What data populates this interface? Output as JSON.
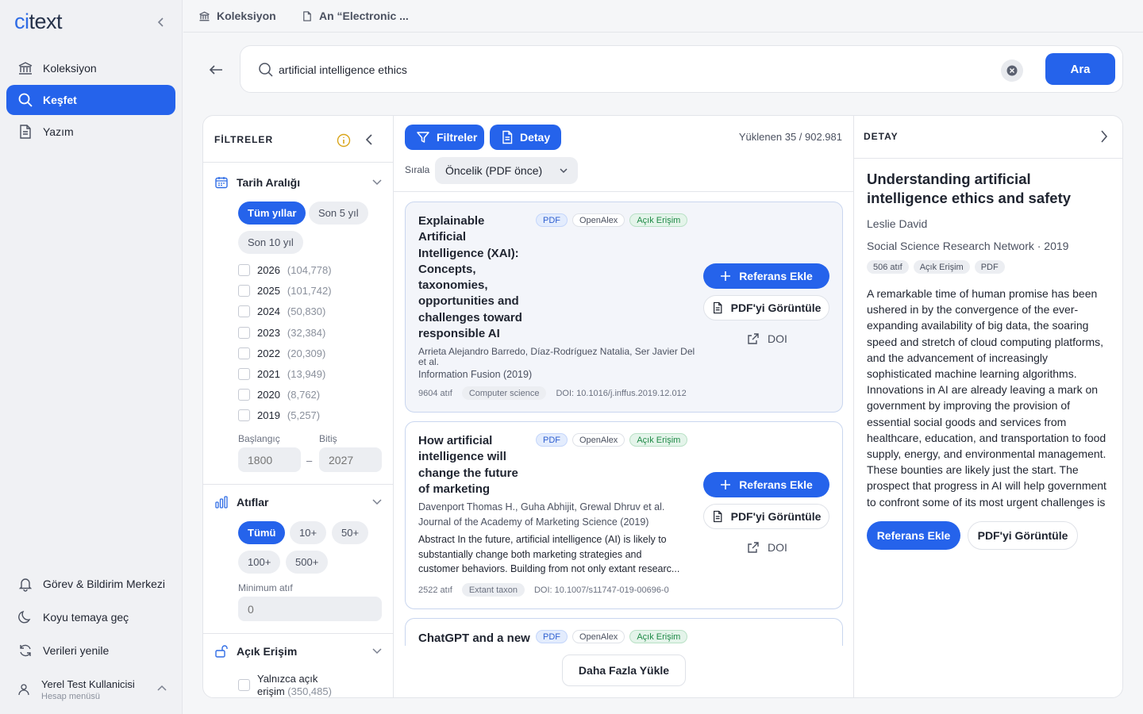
{
  "app": {
    "logo_prefix": "ci",
    "logo_suffix": "text",
    "accent": "#2563eb"
  },
  "sidebar": {
    "items": [
      {
        "label": "Koleksiyon",
        "icon": "library-icon"
      },
      {
        "label": "Keşfet",
        "icon": "search-icon"
      },
      {
        "label": "Yazım",
        "icon": "document-icon"
      }
    ],
    "bottom": [
      {
        "label": "Görev & Bildirim Merkezi",
        "icon": "bell-icon"
      },
      {
        "label": "Koyu temaya geç",
        "icon": "moon-icon"
      },
      {
        "label": "Verileri yenile",
        "icon": "refresh-icon"
      }
    ],
    "user": {
      "name": "Yerel Test Kullanicisi",
      "sub": "Hesap menüsü"
    }
  },
  "topbar": {
    "crumbs": [
      "Koleksiyon",
      "An “Electronic ..."
    ]
  },
  "search": {
    "value": "artificial intelligence ethics",
    "button": "Ara"
  },
  "filters": {
    "title": "FİLTRELER",
    "date": {
      "label": "Tarih Aralığı",
      "pills": [
        "Tüm yıllar",
        "Son 5 yıl",
        "Son 10 yıl"
      ],
      "years": [
        {
          "year": "2026",
          "count": "(104,778)"
        },
        {
          "year": "2025",
          "count": "(101,742)"
        },
        {
          "year": "2024",
          "count": "(50,830)"
        },
        {
          "year": "2023",
          "count": "(32,384)"
        },
        {
          "year": "2022",
          "count": "(20,309)"
        },
        {
          "year": "2021",
          "count": "(13,949)"
        },
        {
          "year": "2020",
          "count": "(8,762)"
        },
        {
          "year": "2019",
          "count": "(5,257)"
        }
      ],
      "start_label": "Başlangıç",
      "end_label": "Bitiş",
      "start_placeholder": "1800",
      "end_placeholder": "2027",
      "dash": "–"
    },
    "citations": {
      "label": "Atıflar",
      "pills": [
        "Tümü",
        "10+",
        "50+",
        "100+",
        "500+"
      ],
      "min_label": "Minimum atıf",
      "min_placeholder": "0"
    },
    "open_access": {
      "label": "Açık Erişim",
      "option_line1": "Yalnızca açık",
      "option_line2": "erişim",
      "count": "(350,485)"
    }
  },
  "results": {
    "filters_button": "Filtreler",
    "detail_button": "Detay",
    "loaded": "Yüklenen 35 / 902.981",
    "sort_label": "Sırala",
    "sort_value": "Öncelik (PDF önce)",
    "load_more": "Daha Fazla Yükle",
    "actions": {
      "add": "Referans Ekle",
      "view": "PDF'yi Görüntüle",
      "doi": "DOI"
    },
    "cards": [
      {
        "title_lines": [
          "Explainable",
          "Artificial",
          "Intelligence (XAI):",
          "Concepts,",
          "taxonomies,",
          "opportunities and",
          "challenges toward",
          "responsible AI"
        ],
        "badges": [
          "PDF",
          "OpenAlex",
          "Açık Erişim"
        ],
        "authors": "Arrieta Alejandro Barredo, Díaz-Rodríguez Natalia, Ser Javier Del et al.",
        "venue": "Information Fusion (2019)",
        "citations": "9604 atıf",
        "tag": "Computer science",
        "doi": "DOI: 10.1016/j.inffus.2019.12.012"
      },
      {
        "title_lines": [
          "How artificial",
          "intelligence will",
          "change the future",
          "of marketing"
        ],
        "badges": [
          "PDF",
          "OpenAlex",
          "Açık Erişim"
        ],
        "authors": "Davenport Thomas H., Guha Abhijit, Grewal Dhruv et al.",
        "venue": "Journal of the Academy of Marketing Science (2019)",
        "abstract_lines": [
          "Abstract In the future, artificial intelligence (AI) is likely to",
          "substantially change both marketing strategies and",
          "customer behaviors. Building from not only extant researc..."
        ],
        "citations": "2522 atıf",
        "tag": "Extant taxon",
        "doi": "DOI: 10.1007/s11747-019-00696-0"
      },
      {
        "title_lines": [
          "ChatGPT and a new"
        ],
        "badges": [
          "PDF",
          "OpenAlex",
          "Açık Erişim"
        ]
      }
    ]
  },
  "detail": {
    "header": "DETAY",
    "title": "Understanding artificial intelligence ethics and safety",
    "author": "Leslie David",
    "venue": "Social Science Research Network · 2019",
    "badges": [
      "506 atıf",
      "Açık Erişim",
      "PDF"
    ],
    "abstract": "A remarkable time of human promise has been ushered in by the convergence of the ever-expanding availability of big data, the soaring speed and stretch of cloud computing platforms, and the advancement of increasingly sophisticated machine learning algorithms. Innovations in AI are already leaving a mark on government by improving the provision of essential social goods and services from healthcare, education, and transportation to food supply, energy, and environmental management. These bounties are likely just the start. The prospect that progress in AI will help government to confront some of its most urgent challenges is",
    "add_button": "Referans Ekle",
    "view_button": "PDF'yi Görüntüle"
  }
}
